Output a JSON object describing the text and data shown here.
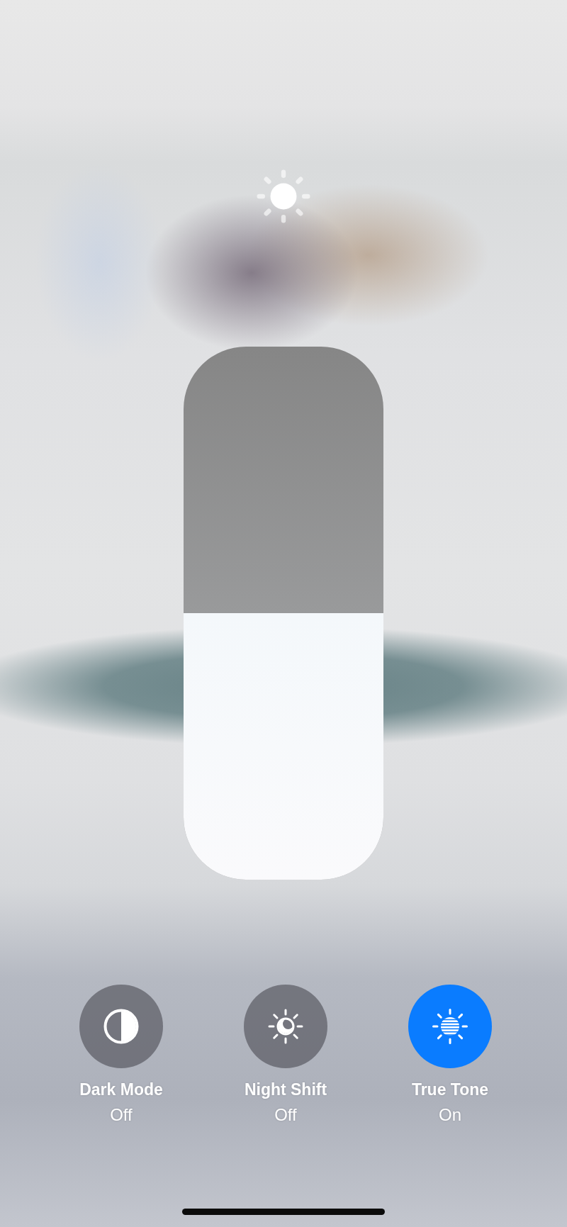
{
  "brightness_slider": {
    "level": 0.5
  },
  "toggles": [
    {
      "kind": "dark_mode",
      "label": "Dark Mode",
      "status": "Off",
      "on": false
    },
    {
      "kind": "night_shift",
      "label": "Night Shift",
      "status": "Off",
      "on": false
    },
    {
      "kind": "true_tone",
      "label": "True Tone",
      "status": "On",
      "on": true
    }
  ]
}
